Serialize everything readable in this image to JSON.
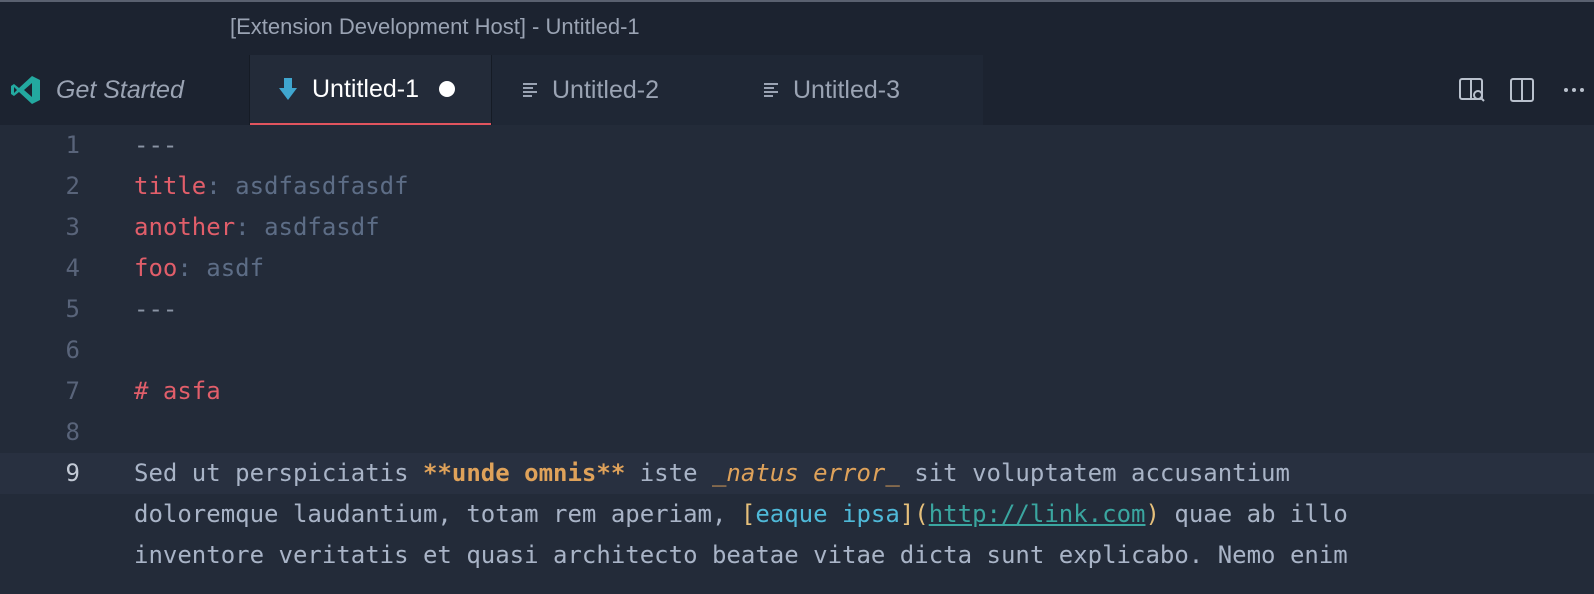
{
  "window": {
    "title": "[Extension Development Host] - Untitled-1"
  },
  "tabs": [
    {
      "label": "Get Started",
      "icon": "vscode-logo-icon"
    },
    {
      "label": "Untitled-1",
      "icon": "markdown-down-arrow-icon",
      "dirty": true
    },
    {
      "label": "Untitled-2",
      "icon": "lines-icon"
    },
    {
      "label": "Untitled-3",
      "icon": "lines-icon"
    }
  ],
  "editor_actions": [
    "open-preview-icon",
    "split-editor-icon",
    "more-actions-icon"
  ],
  "editor": {
    "current_line": 9,
    "lines": [
      {
        "num": "1",
        "dash": "---"
      },
      {
        "num": "2",
        "key": "title",
        "colon": ": ",
        "value": "asdfasdfasdf"
      },
      {
        "num": "3",
        "key": "another",
        "colon": ": ",
        "value": "asdfasdf"
      },
      {
        "num": "4",
        "key": "foo",
        "colon": ": ",
        "value": "asdf"
      },
      {
        "num": "5",
        "dash": "---"
      },
      {
        "num": "6"
      },
      {
        "num": "7",
        "heading": "# asfa"
      },
      {
        "num": "8"
      },
      {
        "num": "9",
        "text1": "Sed ut perspiciatis ",
        "bold": "**unde omnis**",
        "text2": " iste ",
        "italic": "_natus error_",
        "text3": " sit voluptatem accusantium"
      },
      {
        "num": "",
        "text1": "doloremque laudantium, totam rem aperiam, ",
        "bracket_open": "[",
        "link_text": "eaque ipsa",
        "bracket_mid": "](",
        "url": "http://link.com",
        "paren_close": ")",
        "text2": " quae ab illo"
      },
      {
        "num": "",
        "text1": "inventore veritatis et quasi architecto beatae vitae dicta sunt explicabo. Nemo enim"
      }
    ]
  },
  "colors": {
    "accent_tab_border": "#e1545e",
    "yaml_key": "#e15e6a",
    "bold_italic": "#dfa25a",
    "link": "#4fb9d8"
  }
}
